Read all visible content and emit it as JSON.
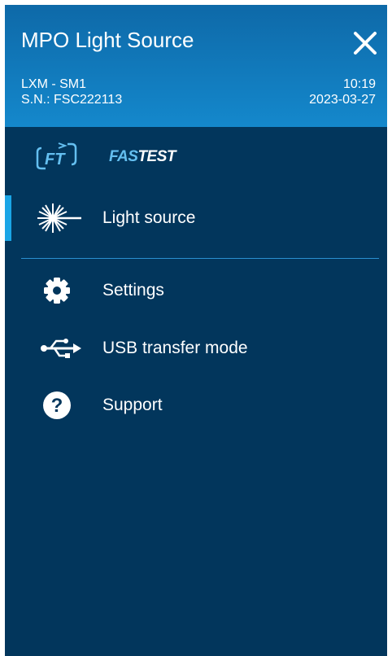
{
  "header": {
    "title": "MPO Light Source",
    "device_model": "LXM - SM1",
    "serial": "S.N.: FSC222113",
    "time": "10:19",
    "date": "2023-03-27"
  },
  "brand": {
    "logo_text": "FT",
    "name_part1": "FAS",
    "name_part2": "TEST"
  },
  "menu": {
    "items": [
      {
        "label": "Light source",
        "icon": "laser-burst-icon",
        "active": true
      },
      {
        "label": "Settings",
        "icon": "gear-icon"
      },
      {
        "label": "USB transfer mode",
        "icon": "usb-icon"
      },
      {
        "label": "Support",
        "icon": "help-circle-icon"
      }
    ]
  },
  "colors": {
    "header_blue": "#1488cc",
    "panel_navy": "#02365c",
    "accent": "#1aa5e6"
  }
}
